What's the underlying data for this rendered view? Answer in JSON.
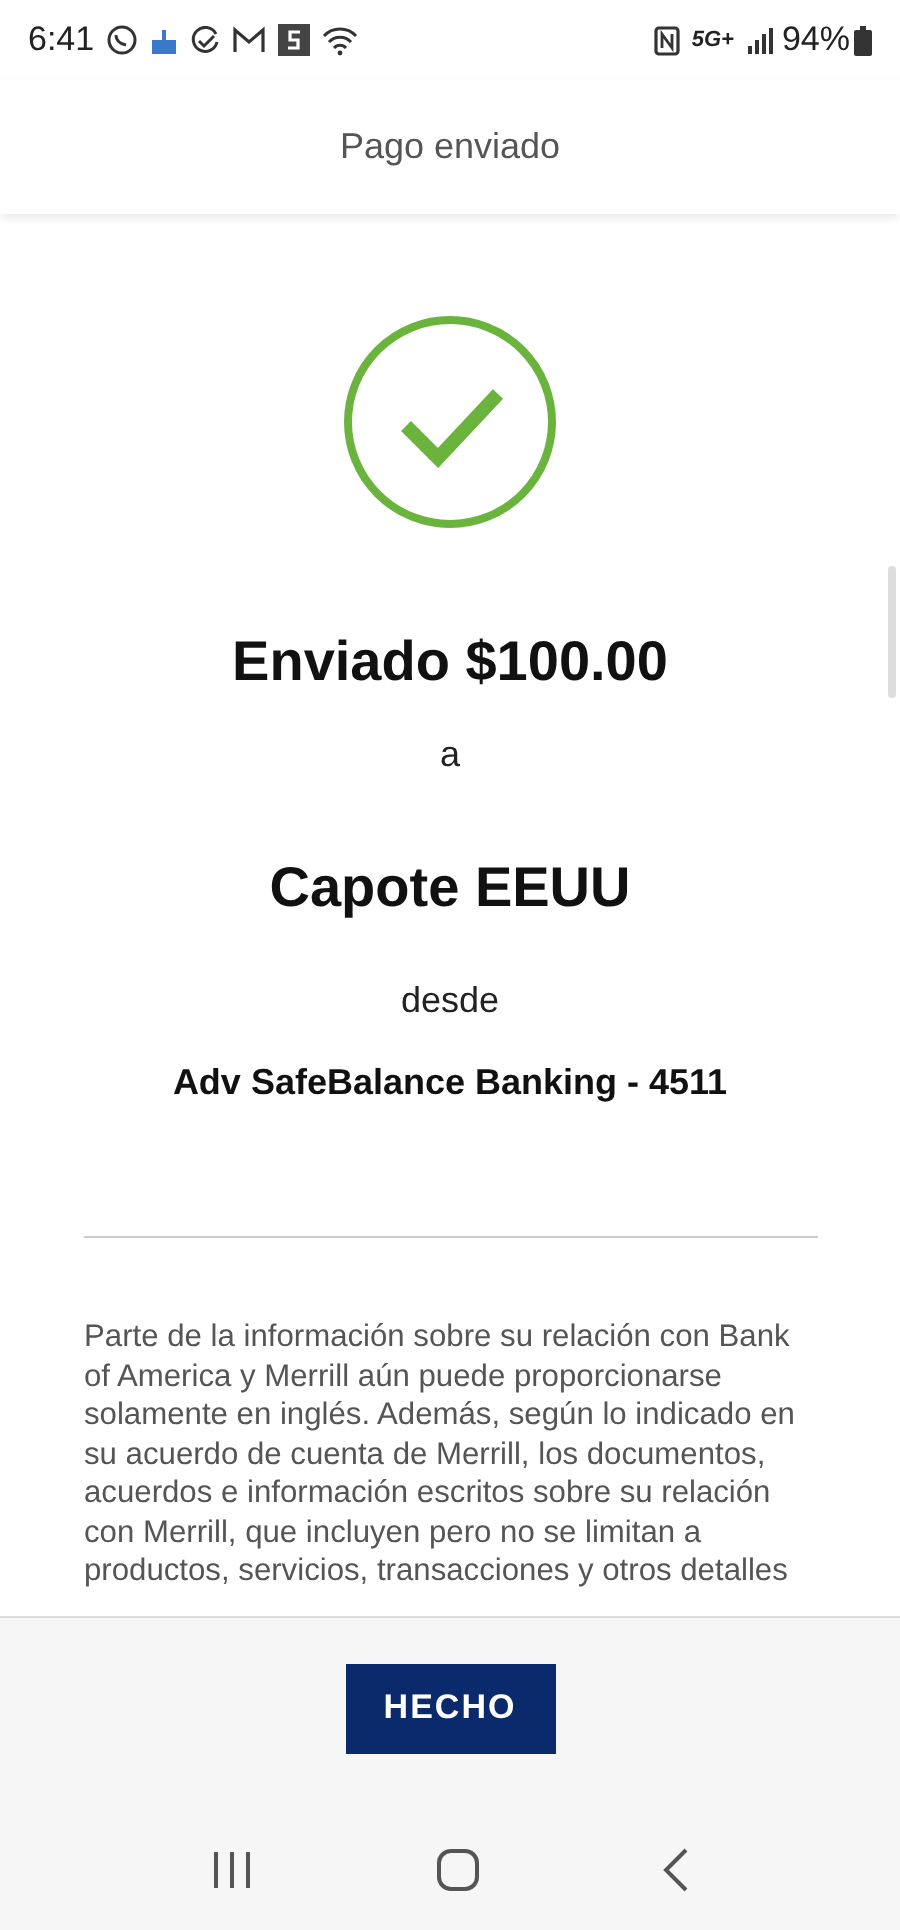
{
  "status_bar": {
    "time": "6:41",
    "network": "5G+",
    "battery": "94%"
  },
  "header": {
    "title": "Pago enviado"
  },
  "receipt": {
    "amount_line": "Enviado $100.00",
    "to_word": "a",
    "recipient": "Capote EEUU",
    "from_word": "desde",
    "account": "Adv SafeBalance Banking - 4511"
  },
  "disclaimer": "Parte de la información sobre su relación con Bank of America y Merrill aún puede proporcionarse solamente en inglés. Además, según lo indicado en su acuerdo de cuenta de Merrill, los documentos, acuerdos e información escritos sobre su relación con Merrill, que incluyen pero no se limitan a productos, servicios, transacciones y otros detalles",
  "footer": {
    "button": "HECHO"
  }
}
